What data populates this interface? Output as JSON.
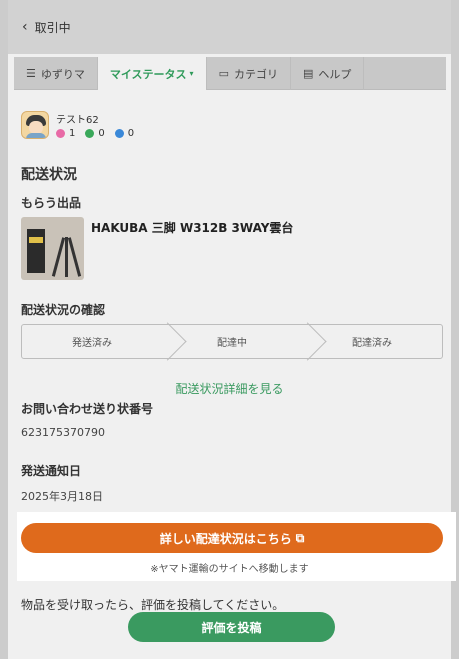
{
  "header": {
    "back_label": "取引中"
  },
  "tabs": [
    {
      "icon": "list-icon",
      "label": "ゆずりマ"
    },
    {
      "icon": "",
      "label": "マイステータス",
      "active": true
    },
    {
      "icon": "folder-icon",
      "label": "カテゴリ"
    },
    {
      "icon": "document-icon",
      "label": "ヘルプ"
    }
  ],
  "user": {
    "name": "テスト62",
    "ratings": [
      {
        "icon": "good-face-icon",
        "color": "#e86aa6",
        "count": "1"
      },
      {
        "icon": "normal-face-icon",
        "color": "#3aa85a",
        "count": "0"
      },
      {
        "icon": "bad-face-icon",
        "color": "#3a88d8",
        "count": "0"
      }
    ]
  },
  "section_title": "配送状況",
  "product": {
    "heading": "もらう出品",
    "title": "HAKUBA 三脚 W312B 3WAY雲台"
  },
  "status": {
    "heading": "配送状況の確認",
    "steps": [
      "発送済み",
      "配達中",
      "配達済み"
    ],
    "detail_link": "配送状況詳細を見る"
  },
  "tracking": {
    "label": "お問い合わせ送り状番号",
    "value": "623175370790"
  },
  "notify": {
    "label": "発送通知日",
    "value": "2025年3月18日"
  },
  "carrier": {
    "button_label": "詳しい配達状況はこちら",
    "note": "※ヤマト運輸のサイトへ移動します"
  },
  "review": {
    "instruction": "物品を受け取ったら、評価を投稿してください。",
    "button_label": "評価を投稿"
  },
  "colors": {
    "accent_green": "#3a9a60",
    "accent_orange": "#df6a1c"
  }
}
